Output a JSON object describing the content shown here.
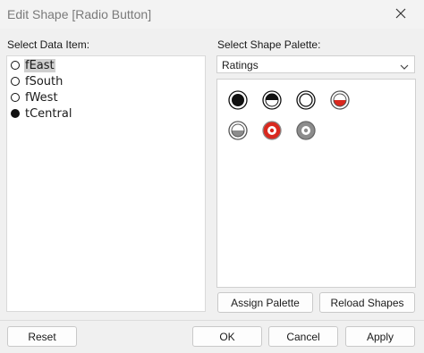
{
  "window": {
    "title": "Edit Shape [Radio Button]",
    "close_icon": "close-icon"
  },
  "data_items": {
    "label": "Select Data Item:",
    "items": [
      {
        "label": "fEast",
        "selected": true,
        "filled": false
      },
      {
        "label": "fSouth",
        "selected": false,
        "filled": false
      },
      {
        "label": "fWest",
        "selected": false,
        "filled": false
      },
      {
        "label": "tCentral",
        "selected": false,
        "filled": true
      }
    ]
  },
  "palette": {
    "label": "Select Shape Palette:",
    "selected": "Ratings",
    "shapes": [
      "filled-circle-icon",
      "half-filled-circle-icon",
      "ring-circle-icon",
      "red-half-circle-icon",
      "gray-half-circle-icon",
      "red-target-circle-icon",
      "gray-target-circle-icon"
    ],
    "colors": {
      "red": "#d9281e",
      "gray": "#8c8c8c",
      "black": "#111111"
    }
  },
  "buttons": {
    "assign_palette": "Assign Palette",
    "reload_shapes": "Reload Shapes",
    "reset": "Reset",
    "ok": "OK",
    "cancel": "Cancel",
    "apply": "Apply"
  }
}
